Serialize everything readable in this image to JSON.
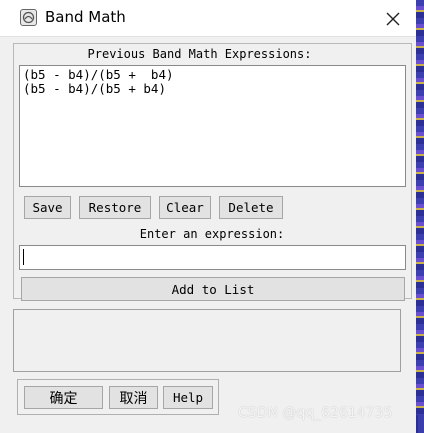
{
  "window": {
    "title": "Band Math",
    "icon": "envi-app-icon",
    "close_icon": "close-icon"
  },
  "previous_section": {
    "label": "Previous Band Math Expressions:",
    "expressions": [
      "(b5 - b4)/(b5 +  b4)",
      "(b5 - b4)/(b5 + b4)"
    ]
  },
  "list_buttons": {
    "save": "Save",
    "restore": "Restore",
    "clear": "Clear",
    "delete": "Delete"
  },
  "expression_entry": {
    "label": "Enter an expression:",
    "value": "",
    "add_button": "Add to List"
  },
  "dialog_buttons": {
    "ok": "确定",
    "cancel": "取消",
    "help": "Help"
  },
  "watermark": "CSDN @qq_62614735",
  "colors": {
    "window_bg": "#f0f0f0",
    "button_bg": "#e2e2e2",
    "background_image_accent": "#3b3fb0"
  }
}
